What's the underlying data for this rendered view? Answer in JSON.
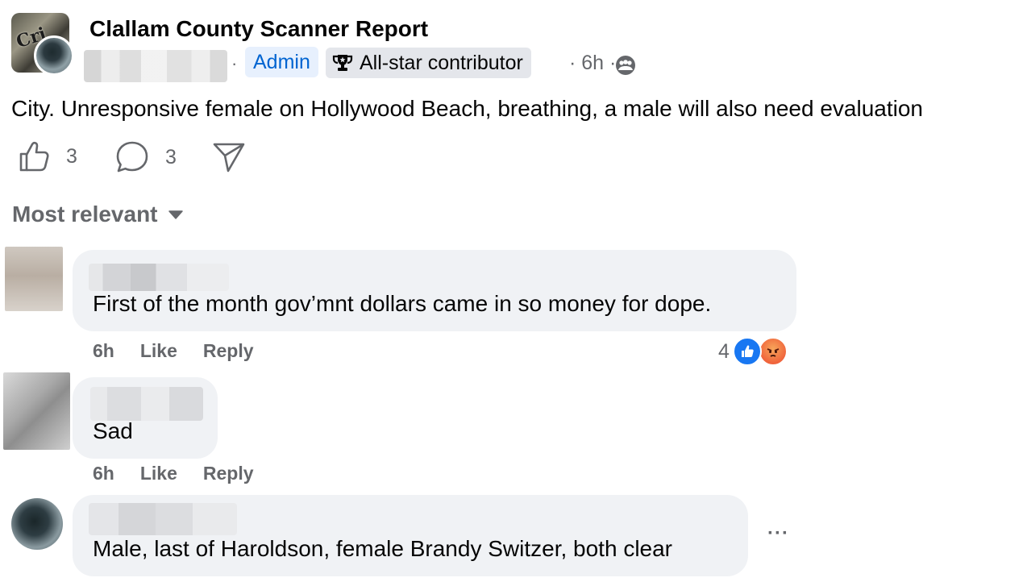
{
  "post": {
    "group_name": "Clallam County Scanner Report",
    "group_logo_text": "Cri",
    "author_badge_admin": "Admin",
    "author_badge_star": "All-star contributor",
    "time": "6h",
    "separator": "·",
    "text": "City. Unresponsive female on Hollywood Beach, breathing, a male will also need evaluation",
    "like_count": "3",
    "comment_count": "3"
  },
  "sort": {
    "label": "Most relevant"
  },
  "comments": [
    {
      "text": "First of the month gov’mnt dollars came in so money for dope.",
      "time": "6h",
      "like_label": "Like",
      "reply_label": "Reply",
      "reaction_count": "4",
      "reactions": [
        "like-icon",
        "angry-icon"
      ]
    },
    {
      "text": "Sad",
      "time": "6h",
      "like_label": "Like",
      "reply_label": "Reply"
    },
    {
      "text": "Male, last of Haroldson, female Brandy Switzer, both clear",
      "more_label": "···"
    }
  ],
  "colors": {
    "admin_bg": "#e7f0fd",
    "admin_text": "#0064d1",
    "bubble_bg": "#f0f2f5",
    "secondary_text": "#65676b",
    "like_blue": "#1877f2",
    "angry_orange": "#f0643c"
  }
}
